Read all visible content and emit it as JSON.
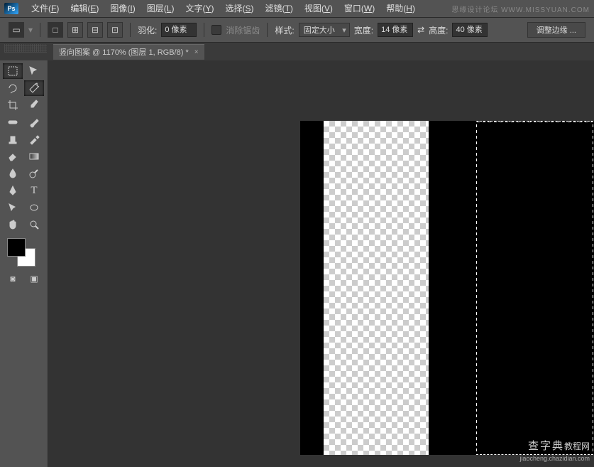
{
  "app": {
    "logo_text": "Ps"
  },
  "menu": [
    {
      "label": "文件",
      "key": "F"
    },
    {
      "label": "编辑",
      "key": "E"
    },
    {
      "label": "图像",
      "key": "I"
    },
    {
      "label": "图层",
      "key": "L"
    },
    {
      "label": "文字",
      "key": "Y"
    },
    {
      "label": "选择",
      "key": "S"
    },
    {
      "label": "滤镜",
      "key": "T"
    },
    {
      "label": "视图",
      "key": "V"
    },
    {
      "label": "窗口",
      "key": "W"
    },
    {
      "label": "帮助",
      "key": "H"
    }
  ],
  "watermark_top": "思缘设计论坛  WWW.MISSYUAN.COM",
  "options": {
    "feather_label": "羽化:",
    "feather_value": "0 像素",
    "antialias_label": "消除锯齿",
    "style_label": "样式:",
    "style_value": "固定大小",
    "width_label": "宽度:",
    "width_value": "14 像素",
    "height_label": "高度:",
    "height_value": "40 像素",
    "refine_edge": "调整边缘 ..."
  },
  "tab": {
    "title": "竖向图案 @ 1170% (图层 1, RGB/8) *",
    "close": "×"
  },
  "tools": {
    "marquee": "marquee",
    "move": "move",
    "lasso": "lasso",
    "wand": "wand",
    "crop": "crop",
    "eyedrop": "eyedrop",
    "heal": "heal",
    "brush": "brush",
    "stamp": "stamp",
    "history": "history",
    "eraser": "eraser",
    "gradient": "gradient",
    "blur": "blur",
    "dodge": "dodge",
    "pen": "pen",
    "type": "type",
    "path": "path",
    "shape": "shape",
    "hand": "hand",
    "zoom": "zoom"
  },
  "colors": {
    "fg": "#000000",
    "bg": "#ffffff"
  },
  "watermark_br": {
    "brand_cn": "查字典",
    "brand_suffix": "教程网",
    "url": "jiaocheng.chazidian.com"
  }
}
